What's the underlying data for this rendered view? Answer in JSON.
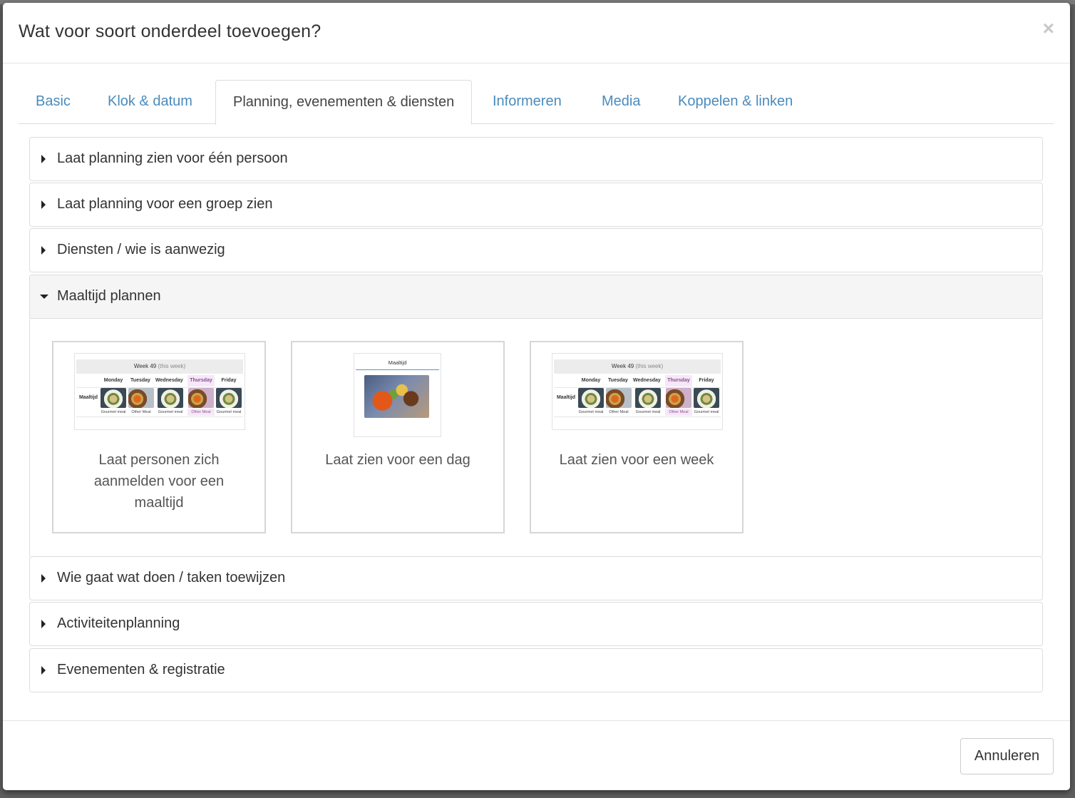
{
  "modal": {
    "title": "Wat voor soort onderdeel toevoegen?",
    "close_glyph": "×"
  },
  "tabs": [
    {
      "label": "Basic",
      "active": false
    },
    {
      "label": "Klok & datum",
      "active": false
    },
    {
      "label": "Planning, evenementen & diensten",
      "active": true
    },
    {
      "label": "Informeren",
      "active": false
    },
    {
      "label": "Media",
      "active": false
    },
    {
      "label": "Koppelen & linken",
      "active": false
    }
  ],
  "panels": [
    {
      "label": "Laat planning zien voor één persoon",
      "open": false
    },
    {
      "label": "Laat planning voor een groep zien",
      "open": false
    },
    {
      "label": "Diensten / wie is aanwezig",
      "open": false
    },
    {
      "label": "Maaltijd plannen",
      "open": true
    },
    {
      "label": "Wie gaat wat doen / taken toewijzen",
      "open": false
    },
    {
      "label": "Activiteitenplanning",
      "open": false
    },
    {
      "label": "Evenementen & registratie",
      "open": false
    }
  ],
  "cards": [
    {
      "label": "Laat personen zich aanmelden voor een maaltijd",
      "thumbnail": "week"
    },
    {
      "label": "Laat zien voor een dag",
      "thumbnail": "day"
    },
    {
      "label": "Laat zien voor een week",
      "thumbnail": "week"
    }
  ],
  "thumb_week": {
    "header_main": "Week 49",
    "header_muted": "(this week)",
    "days": [
      "Monday",
      "Tuesday",
      "Wednesday",
      "Thursday",
      "Friday"
    ],
    "highlight_day": "Thursday",
    "row_label": "Maaltijd",
    "captions": [
      "Gourmet meal",
      "Other Meal",
      "Gourmet meal",
      "Other Meal",
      "Gourmet meal"
    ],
    "highlight_color": "#f6e8f6"
  },
  "thumb_day": {
    "title": "Maaltijd"
  },
  "footer": {
    "cancel_label": "Annuleren"
  },
  "colors": {
    "tab_link": "#4a8bbd",
    "border": "#dddddd",
    "open_panel_bg": "#f5f5f5"
  }
}
